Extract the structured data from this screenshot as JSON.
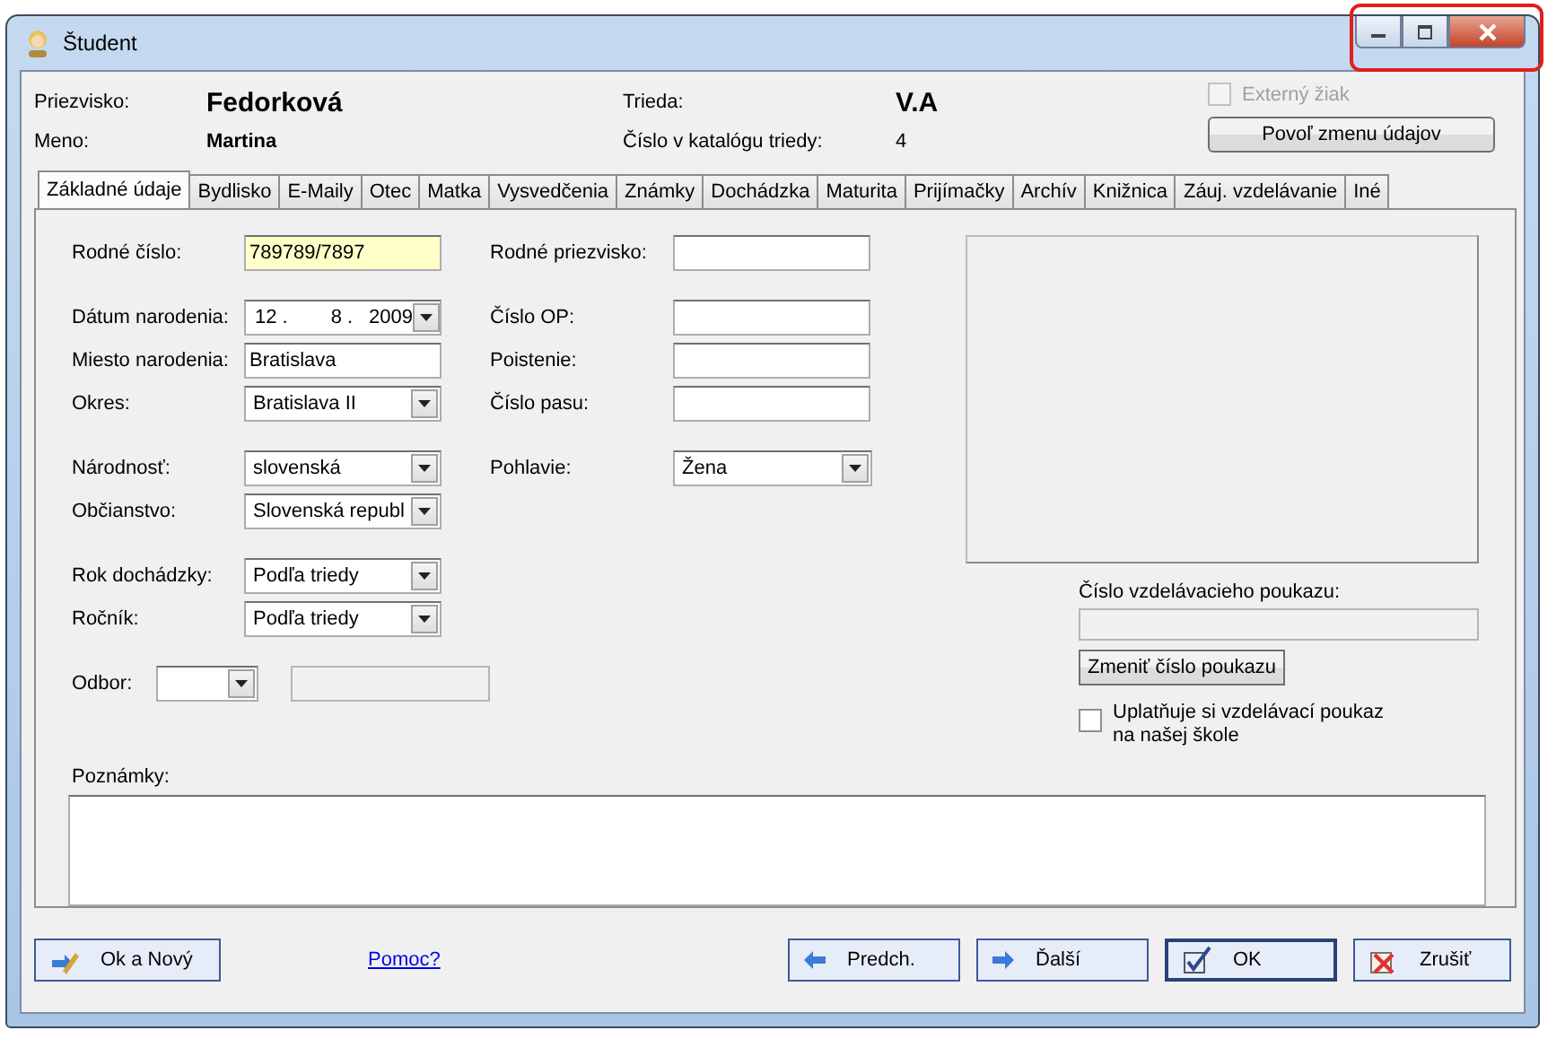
{
  "window": {
    "title": "Študent"
  },
  "header": {
    "surname_label": "Priezvisko:",
    "surname": "Fedorková",
    "name_label": "Meno:",
    "name": "Martina",
    "class_label": "Trieda:",
    "class": "V.A",
    "catalog_label": "Číslo v katalógu triedy:",
    "catalog_number": "4",
    "external": {
      "label": "Externý žiak",
      "checked": false,
      "disabled": true
    },
    "enable_button": "Povoľ zmenu údajov"
  },
  "tabs": [
    {
      "label": "Základné údaje",
      "selected": true
    },
    {
      "label": "Bydlisko",
      "selected": false
    },
    {
      "label": "E-Maily",
      "selected": false
    },
    {
      "label": "Otec",
      "selected": false
    },
    {
      "label": "Matka",
      "selected": false
    },
    {
      "label": "Vysvedčenia",
      "selected": false
    },
    {
      "label": "Známky",
      "selected": false
    },
    {
      "label": "Dochádzka",
      "selected": false
    },
    {
      "label": "Maturita",
      "selected": false
    },
    {
      "label": "Prijímačky",
      "selected": false
    },
    {
      "label": "Archív",
      "selected": false
    },
    {
      "label": "Knižnica",
      "selected": false
    },
    {
      "label": "Záuj. vzdelávanie",
      "selected": false
    },
    {
      "label": "Iné",
      "selected": false
    }
  ],
  "form_groups": [
    [
      {
        "left": {
          "label": "Rodné číslo:",
          "kind": "text",
          "value": "789789/7897",
          "highlighted": true
        },
        "right": {
          "label": "Rodné priezvisko:",
          "kind": "text",
          "highlighted": false
        }
      }
    ],
    [
      {
        "left": {
          "label": "Dátum narodenia:",
          "kind": "date",
          "day": "12",
          "month": "8",
          "year": "2009",
          "separators": [
            ".",
            "."
          ]
        },
        "right": {
          "label": "Číslo OP:",
          "kind": "text",
          "highlighted": false
        }
      },
      {
        "left": {
          "label": "Miesto narodenia:",
          "kind": "text",
          "value": "Bratislava",
          "highlighted": false
        },
        "right": {
          "label": "Poistenie:",
          "kind": "text",
          "highlighted": false
        }
      },
      {
        "left": {
          "label": "Okres:",
          "kind": "combo",
          "value": "Bratislava II"
        },
        "right": {
          "label": "Číslo pasu:",
          "kind": "text",
          "highlighted": false
        }
      }
    ],
    [
      {
        "left": {
          "label": "Národnosť:",
          "kind": "combo",
          "value": "slovenská"
        },
        "right": {
          "label": "Pohlavie:",
          "kind": "combo",
          "value": "Žena"
        }
      },
      {
        "left": {
          "label": "Občianstvo:",
          "kind": "combo",
          "value": "Slovenská republ"
        }
      }
    ],
    [
      {
        "left": {
          "label": "Rok dochádzky:",
          "kind": "combo",
          "value": "Podľa triedy"
        }
      },
      {
        "left": {
          "label": "Ročník:",
          "kind": "combo",
          "value": "Podľa triedy"
        }
      }
    ],
    [
      {
        "left": {
          "label": "Odbor:",
          "kind": "combo_extra"
        }
      }
    ]
  ],
  "voucher": {
    "label": "Číslo vzdelávacieho poukazu:",
    "button": "Zmeniť číslo poukazu",
    "checkbox": {
      "label": "Uplatňuje si vzdelávací poukaz na našej škole",
      "checked": false
    }
  },
  "notes": {
    "label": "Poznámky:"
  },
  "footer": {
    "buttons_left": [
      {
        "label": "Ok a Nový",
        "kind": "edit"
      }
    ],
    "help_link": "Pomoc?",
    "buttons_right": [
      {
        "label": "Predch.",
        "kind": "previous",
        "default": false
      },
      {
        "label": "Ďalší",
        "kind": "next",
        "default": false
      },
      {
        "label": "OK",
        "kind": "confirm",
        "default": true
      },
      {
        "label": "Zrušiť",
        "kind": "cancel",
        "default": false
      }
    ]
  }
}
